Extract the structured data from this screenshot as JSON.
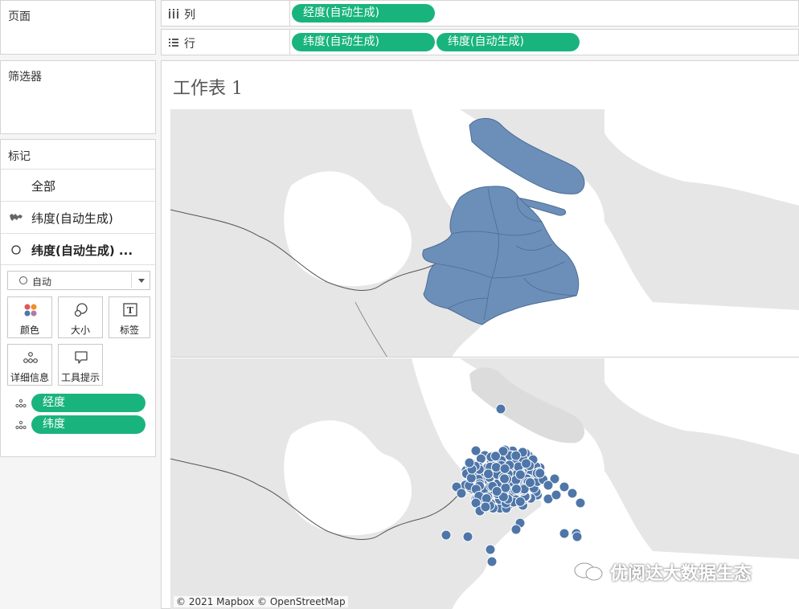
{
  "left_panel": {
    "pages_title": "页面",
    "filters_title": "筛选器",
    "marks": {
      "title": "标记",
      "rows": [
        {
          "label": "全部",
          "icon": "none"
        },
        {
          "label": "纬度(自动生成)",
          "icon": "map-icon"
        },
        {
          "label": "纬度(自动生成) ...",
          "icon": "circle-icon"
        }
      ],
      "mark_type": "自动",
      "cards": [
        {
          "label": "颜色",
          "icon": "color-icon"
        },
        {
          "label": "大小",
          "icon": "size-icon"
        },
        {
          "label": "标签",
          "icon": "label-icon"
        },
        {
          "label": "详细信息",
          "icon": "detail-icon"
        },
        {
          "label": "工具提示",
          "icon": "tooltip-icon"
        }
      ],
      "fields": [
        {
          "label": "经度",
          "icon": "detail-icon"
        },
        {
          "label": "纬度",
          "icon": "detail-icon"
        }
      ]
    }
  },
  "shelves": {
    "columns": {
      "label": "列",
      "pills": [
        "经度(自动生成)"
      ]
    },
    "rows": {
      "label": "行",
      "pills": [
        "纬度(自动生成)",
        "纬度(自动生成)"
      ]
    }
  },
  "sheet": {
    "title": "工作表 1",
    "attribution": "© 2021 Mapbox © OpenStreetMap",
    "watermark": "优阅达大数据生态"
  },
  "colors": {
    "pill_green": "#19b47d",
    "polygon_fill": "#6b8fb8",
    "point_fill": "#4f76a8",
    "map_land": "#e6e6e6",
    "map_water": "#ffffff"
  }
}
